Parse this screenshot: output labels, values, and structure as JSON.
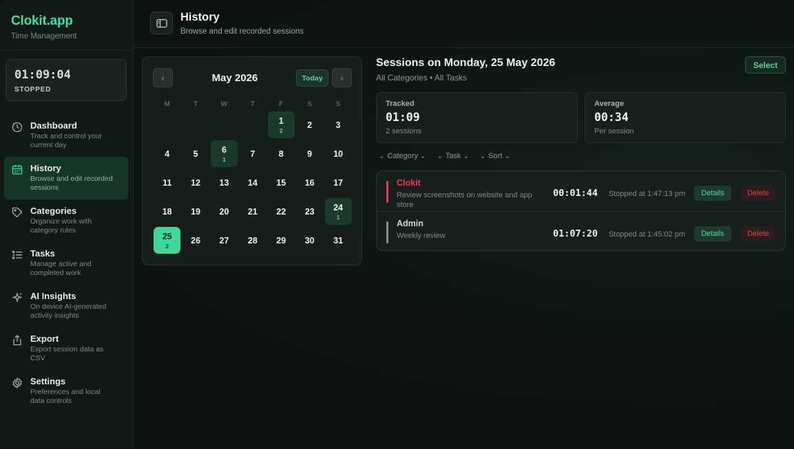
{
  "brand": {
    "name": "Clokit.app",
    "subtitle": "Time Management"
  },
  "timer": {
    "value": "01:09:04",
    "status": "STOPPED"
  },
  "sidebar": {
    "items": [
      {
        "title": "Dashboard",
        "desc": "Track and control your current day",
        "icon": "clock-icon",
        "active": false
      },
      {
        "title": "History",
        "desc": "Browse and edit recorded sessions",
        "icon": "calendar-icon",
        "active": true
      },
      {
        "title": "Categories",
        "desc": "Organize work with category rules",
        "icon": "tag-icon",
        "active": false
      },
      {
        "title": "Tasks",
        "desc": "Manage active and completed work",
        "icon": "list-icon",
        "active": false
      },
      {
        "title": "AI Insights",
        "desc": "On device AI-generated activity insights",
        "icon": "sparkle-icon",
        "active": false
      },
      {
        "title": "Export",
        "desc": "Export session data as CSV",
        "icon": "export-icon",
        "active": false
      },
      {
        "title": "Settings",
        "desc": "Preferences and local data controls",
        "icon": "gear-icon",
        "active": false
      }
    ]
  },
  "header": {
    "title": "History",
    "subtitle": "Browse and edit recorded sessions"
  },
  "calendar": {
    "month": "May 2026",
    "today_label": "Today",
    "weekdays": [
      "M",
      "T",
      "W",
      "T",
      "F",
      "S",
      "S"
    ],
    "weeks": [
      [
        null,
        null,
        null,
        null,
        {
          "d": "1",
          "n": "2"
        },
        {
          "d": "2"
        },
        {
          "d": "3"
        }
      ],
      [
        {
          "d": "4"
        },
        {
          "d": "5"
        },
        {
          "d": "6",
          "n": "1"
        },
        {
          "d": "7"
        },
        {
          "d": "8"
        },
        {
          "d": "9"
        },
        {
          "d": "10"
        }
      ],
      [
        {
          "d": "11"
        },
        {
          "d": "12"
        },
        {
          "d": "13"
        },
        {
          "d": "14"
        },
        {
          "d": "15"
        },
        {
          "d": "16"
        },
        {
          "d": "17"
        }
      ],
      [
        {
          "d": "18"
        },
        {
          "d": "19"
        },
        {
          "d": "20"
        },
        {
          "d": "21"
        },
        {
          "d": "22"
        },
        {
          "d": "23"
        },
        {
          "d": "24",
          "n": "1"
        }
      ],
      [
        {
          "d": "25",
          "n": "2",
          "selected": true
        },
        {
          "d": "26"
        },
        {
          "d": "27"
        },
        {
          "d": "28"
        },
        {
          "d": "29"
        },
        {
          "d": "30"
        },
        {
          "d": "31"
        }
      ]
    ]
  },
  "sessions": {
    "title": "Sessions on Monday, 25 May 2026",
    "subtitle": "All Categories • All Tasks",
    "select_label": "Select",
    "tracked": {
      "label": "Tracked",
      "value": "01:09",
      "note": "2 sessions"
    },
    "average": {
      "label": "Average",
      "value": "00:34",
      "note": "Per session"
    },
    "filters": [
      "Category",
      "Task",
      "Sort"
    ],
    "rows": [
      {
        "name": "Clokit",
        "color": "#f0365a",
        "desc": "Review screenshots on website and app store",
        "duration": "00:01:44",
        "stopped": "Stopped at 1:47:13 pm",
        "details_label": "Details",
        "delete_label": "Delete"
      },
      {
        "name": "Admin",
        "color": "#8a8f8d",
        "desc": "Weekly review",
        "duration": "01:07:20",
        "stopped": "Stopped at 1:45:02 pm",
        "details_label": "Details",
        "delete_label": "Delete"
      }
    ]
  }
}
